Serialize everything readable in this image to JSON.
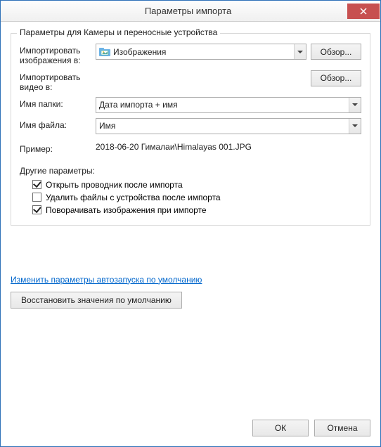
{
  "title": "Параметры импорта",
  "groupbox_title": "Параметры для Камеры и переносные устройства",
  "rows": {
    "images_to": {
      "label": "Импортировать изображения в:",
      "value": "Изображения",
      "browse": "Обзор..."
    },
    "video_to": {
      "label": "Импортировать видео в:",
      "browse": "Обзор..."
    },
    "folder_name": {
      "label": "Имя папки:",
      "value": "Дата импорта + имя"
    },
    "file_name": {
      "label": "Имя файла:",
      "value": "Имя"
    }
  },
  "example": {
    "label": "Пример:",
    "value": "2018-06-20 Гималаи\\Himalayas 001.JPG"
  },
  "other": {
    "title": "Другие параметры:",
    "opt1": {
      "label": "Открыть проводник после импорта",
      "checked": true
    },
    "opt2": {
      "label": "Удалить файлы с устройства после импорта",
      "checked": false
    },
    "opt3": {
      "label": "Поворачивать изображения при импорте",
      "checked": true
    }
  },
  "link": "Изменить параметры автозапуска по умолчанию",
  "restore": "Восстановить значения по умолчанию",
  "footer": {
    "ok": "ОК",
    "cancel": "Отмена"
  }
}
